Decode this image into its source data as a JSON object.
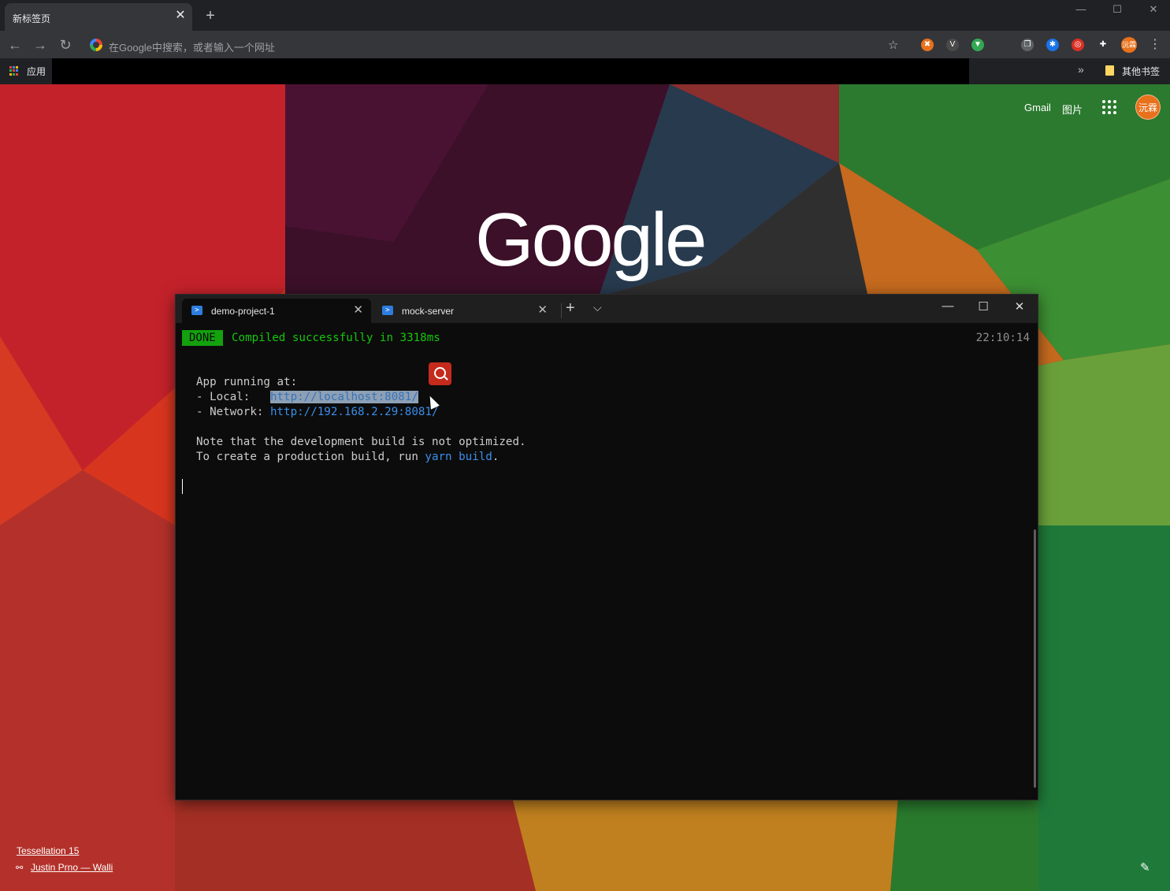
{
  "browser": {
    "tab_title": "新标签页",
    "tab_close": "✕",
    "new_tab": "+",
    "window_controls": {
      "minimize": "—",
      "maximize": "☐",
      "close": "✕"
    },
    "nav": {
      "back": "←",
      "forward": "→",
      "reload": "↻"
    },
    "omnibox_placeholder": "在Google中搜索，或者输入一个网址",
    "bookmark_star": "☆",
    "profile_initials": "沅霖",
    "menu": "⋮",
    "bookmarks": {
      "apps_label": "应用",
      "more": "»",
      "other_label": "其他书签"
    },
    "extensions": [
      {
        "name": "ext-orange-icon",
        "glyph": "✖",
        "color": "#e8711b"
      },
      {
        "name": "ext-vue-icon",
        "glyph": "V",
        "color": "#4a4a4a"
      },
      {
        "name": "ext-marker-icon",
        "glyph": "▼",
        "color": "#34a853"
      },
      {
        "name": "ext-copy-icon",
        "glyph": "❐",
        "color": "#5f6368"
      },
      {
        "name": "ext-star-icon",
        "glyph": "✱",
        "color": "#1a73e8"
      },
      {
        "name": "ext-red-icon",
        "glyph": "◎",
        "color": "#d93025"
      },
      {
        "name": "extensions-puzzle-icon",
        "glyph": "✚",
        "color": "#35363a"
      }
    ]
  },
  "ntp": {
    "gmail": "Gmail",
    "images": "图片",
    "avatar": "沅霖",
    "logo": "Google",
    "credit_title": "Tessellation 15",
    "credit_author": "Justin Prno — Walli",
    "edit_glyph": "✎"
  },
  "terminal": {
    "tabs": [
      {
        "title": "demo-project-1",
        "active": true
      },
      {
        "title": "mock-server",
        "active": false
      }
    ],
    "tab_close": "✕",
    "new_tab": "+",
    "dropdown": "⌵",
    "controls": {
      "minimize": "—",
      "maximize": "☐",
      "close": "✕"
    },
    "done_badge": "DONE",
    "done_message": "Compiled successfully in 3318ms",
    "timestamp": "22:10:14",
    "lines": {
      "app_running": "App running at:",
      "local_label": "- Local:   ",
      "local_url": "http://localhost:8081/",
      "network_label": "- Network: ",
      "network_url": "http://192.168.2.29:8081/",
      "note": "Note that the development build is not optimized.",
      "prod_prefix": "To create a production build, run ",
      "prod_cmd": "yarn build",
      "prod_suffix": "."
    }
  }
}
